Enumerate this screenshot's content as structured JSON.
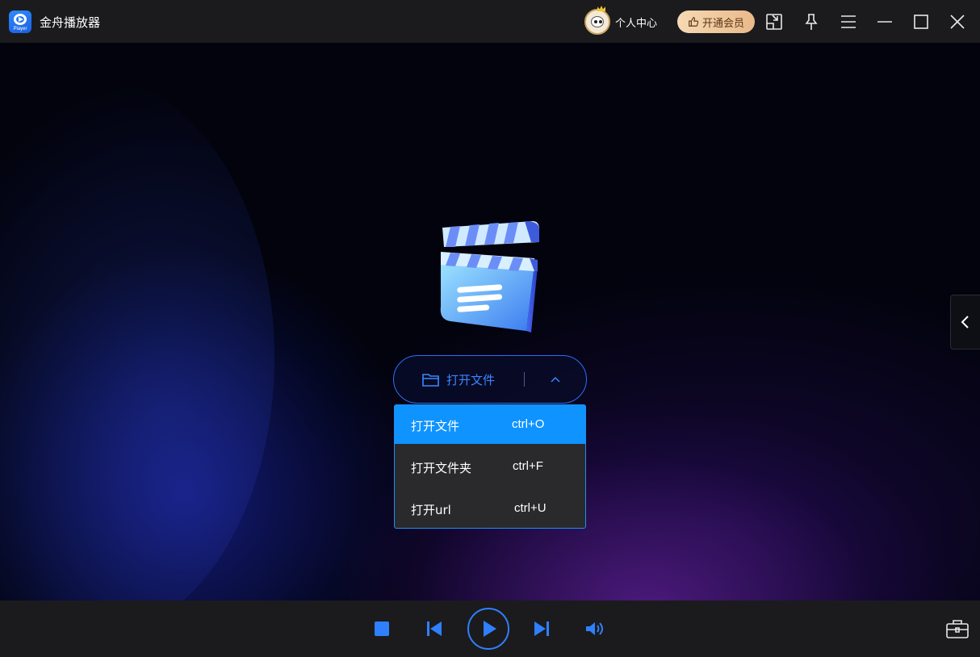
{
  "app": {
    "title": "金舟播放器",
    "logo_label": "Player"
  },
  "header": {
    "personal_center": "个人中心",
    "vip_button": "开通会员",
    "icons": [
      "user-avatar",
      "thumbs-up-icon",
      "mini-window-icon",
      "pin-icon",
      "menu-icon",
      "minimize-icon",
      "maximize-icon",
      "close-icon"
    ]
  },
  "main": {
    "open_button_label": "打开文件",
    "dropdown": [
      {
        "label": "打开文件",
        "shortcut": "ctrl+O",
        "active": true
      },
      {
        "label": "打开文件夹",
        "shortcut": "ctrl+F",
        "active": false
      },
      {
        "label": "打开url",
        "shortcut": "ctrl+U",
        "active": false
      }
    ]
  },
  "controls": {
    "icons": [
      "stop-icon",
      "previous-icon",
      "play-icon",
      "next-icon",
      "volume-icon",
      "toolbox-icon"
    ]
  },
  "colors": {
    "accent": "#2f80ff",
    "menu_active": "#0f93ff",
    "titlebar_bg": "#1b1b1d",
    "vip_gold": "#e9b98a"
  }
}
